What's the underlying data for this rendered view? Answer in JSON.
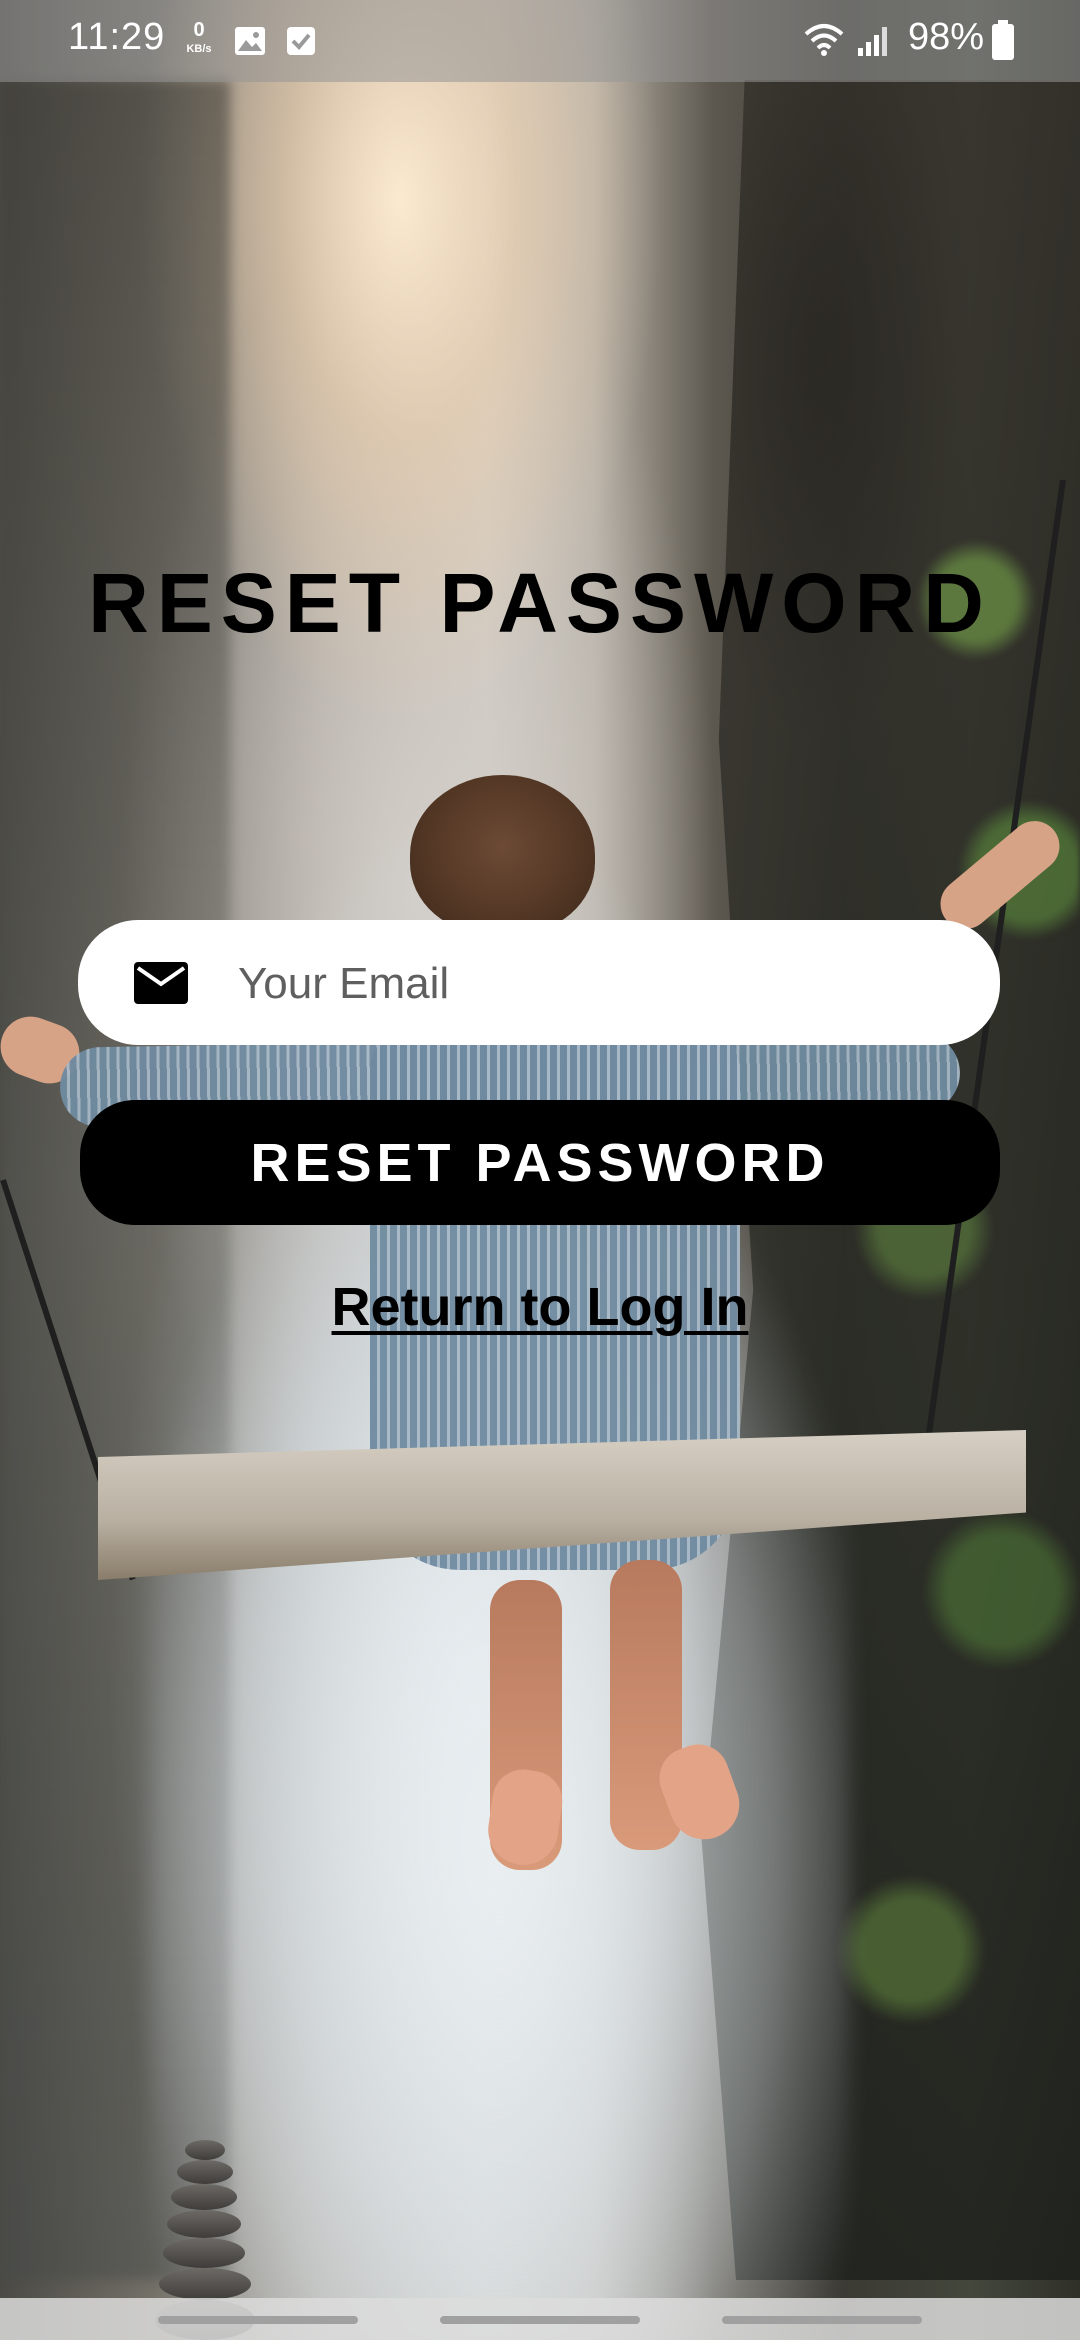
{
  "status_bar": {
    "time": "11:29",
    "speed_value": "0",
    "speed_unit": "KB/s",
    "battery": "98%",
    "icons": [
      "image-icon",
      "checkbox-icon",
      "wifi-icon",
      "signal-icon",
      "battery-icon"
    ]
  },
  "title": "RESET PASSWORD",
  "email": {
    "placeholder": "Your Email",
    "value": "",
    "icon": "mail-icon"
  },
  "reset_button": {
    "label": "RESET PASSWORD"
  },
  "return_link": {
    "label": "Return to Log In"
  },
  "colors": {
    "button_bg": "#000000",
    "button_text": "#ffffff",
    "field_bg": "#ffffff",
    "title_color": "#000000"
  }
}
